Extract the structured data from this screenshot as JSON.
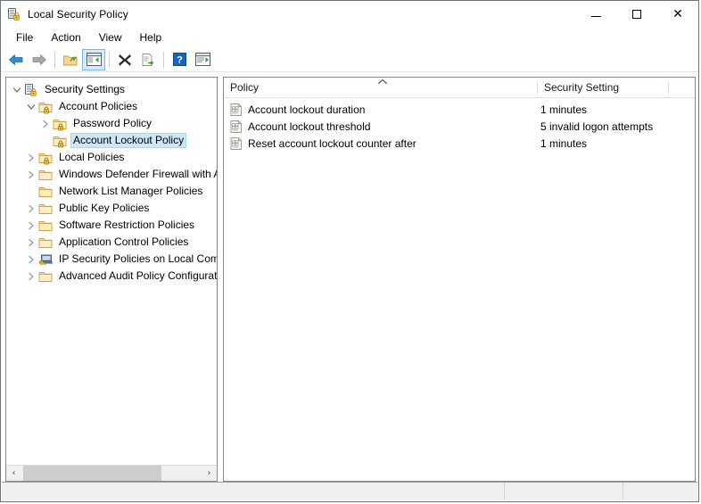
{
  "window": {
    "title": "Local Security Policy",
    "icon": "security-policy-icon",
    "caption": {
      "minimize": "─",
      "maximize": "□",
      "close": "✕"
    }
  },
  "menubar": {
    "items": [
      {
        "label": "File",
        "name": "menu-file"
      },
      {
        "label": "Action",
        "name": "menu-action"
      },
      {
        "label": "View",
        "name": "menu-view"
      },
      {
        "label": "Help",
        "name": "menu-help"
      }
    ]
  },
  "toolbar": {
    "buttons": [
      {
        "name": "back-button",
        "icon": "back-arrow-icon",
        "active": false
      },
      {
        "name": "forward-button",
        "icon": "forward-arrow-icon",
        "active": false
      },
      {
        "name": "up-one-level-button",
        "icon": "folder-up-icon",
        "active": false
      },
      {
        "name": "show-hide-console-tree-button",
        "icon": "console-tree-icon",
        "active": true
      },
      {
        "name": "delete-button",
        "icon": "delete-x-icon",
        "active": false
      },
      {
        "name": "export-list-button",
        "icon": "export-list-icon",
        "active": false
      },
      {
        "name": "help-button",
        "icon": "question-mark-icon",
        "active": false
      },
      {
        "name": "show-action-pane-button",
        "icon": "action-pane-icon",
        "active": false
      }
    ]
  },
  "tree": {
    "nodes": [
      {
        "label": "Security Settings",
        "indent": 0,
        "twisty": "expanded",
        "icon": "security-settings-icon",
        "selected": false
      },
      {
        "label": "Account Policies",
        "indent": 1,
        "twisty": "expanded",
        "icon": "locked-folder-icon",
        "selected": false
      },
      {
        "label": "Password Policy",
        "indent": 2,
        "twisty": "collapsed",
        "icon": "locked-folder-icon",
        "selected": false
      },
      {
        "label": "Account Lockout Policy",
        "indent": 2,
        "twisty": "none",
        "icon": "locked-folder-icon",
        "selected": true
      },
      {
        "label": "Local Policies",
        "indent": 1,
        "twisty": "collapsed",
        "icon": "locked-folder-icon",
        "selected": false
      },
      {
        "label": "Windows Defender Firewall with Adva",
        "indent": 1,
        "twisty": "collapsed",
        "icon": "folder-icon",
        "selected": false
      },
      {
        "label": "Network List Manager Policies",
        "indent": 1,
        "twisty": "none",
        "icon": "folder-icon",
        "selected": false
      },
      {
        "label": "Public Key Policies",
        "indent": 1,
        "twisty": "collapsed",
        "icon": "folder-icon",
        "selected": false
      },
      {
        "label": "Software Restriction Policies",
        "indent": 1,
        "twisty": "collapsed",
        "icon": "folder-icon",
        "selected": false
      },
      {
        "label": "Application Control Policies",
        "indent": 1,
        "twisty": "collapsed",
        "icon": "folder-icon",
        "selected": false
      },
      {
        "label": "IP Security Policies on Local Compute",
        "indent": 1,
        "twisty": "collapsed",
        "icon": "ip-security-icon",
        "selected": false
      },
      {
        "label": "Advanced Audit Policy Configuration",
        "indent": 1,
        "twisty": "collapsed",
        "icon": "folder-icon",
        "selected": false
      }
    ],
    "scrollbar": {
      "left_arrow": "‹",
      "right_arrow": "›"
    }
  },
  "list": {
    "columns": [
      {
        "label": "Policy",
        "name": "column-policy",
        "sorted": "ascending"
      },
      {
        "label": "Security Setting",
        "name": "column-security-setting",
        "sorted": "none"
      }
    ],
    "rows": [
      {
        "policy": "Account lockout duration",
        "setting": "1 minutes",
        "icon": "policy-setting-icon"
      },
      {
        "policy": "Account lockout threshold",
        "setting": "5 invalid logon attempts",
        "icon": "policy-setting-icon"
      },
      {
        "policy": "Reset account lockout counter after",
        "setting": "1 minutes",
        "icon": "policy-setting-icon"
      }
    ]
  },
  "statusbar": {
    "cells": [
      "",
      "",
      ""
    ]
  },
  "colors": {
    "selection": "#cce8f5",
    "selection_border": "#a7d8f0",
    "toolbar_active": "#d7ecfb",
    "toolbar_active_border": "#7eb4ea",
    "window_border": "#6e7377",
    "pane_border": "#828790",
    "status_bg": "#f0f0f0",
    "scroll_thumb": "#cdcdcd",
    "folder_gold": "#f6d28f",
    "folder_gold_dark": "#dfa котор"
  }
}
